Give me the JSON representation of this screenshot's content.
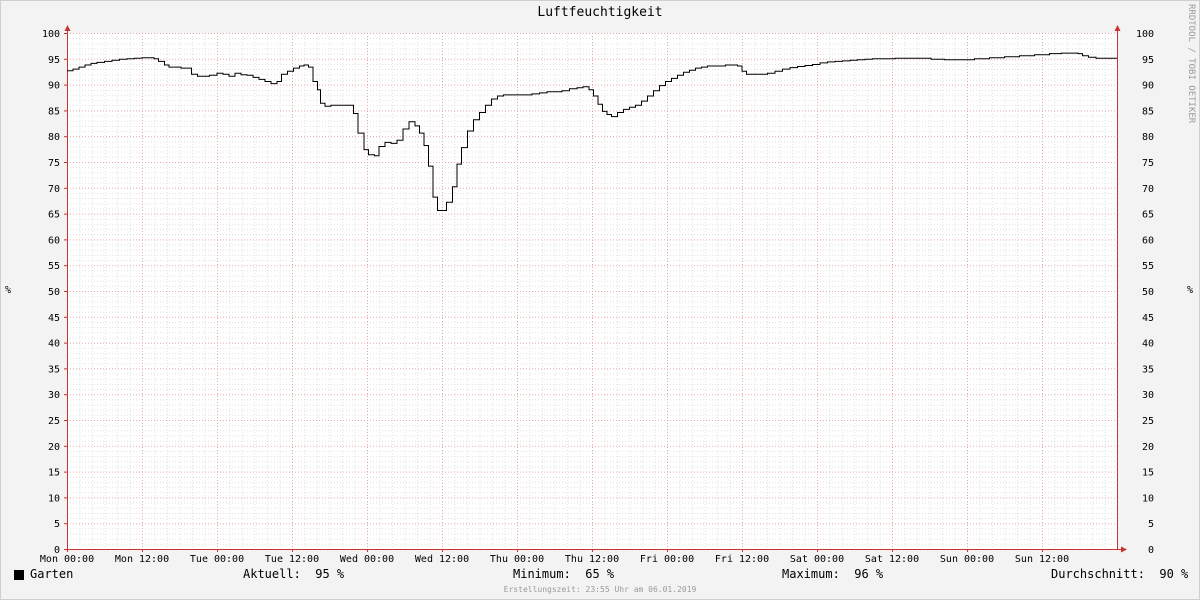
{
  "chart_data": {
    "type": "line",
    "title": "Luftfeuchtigkeit",
    "ylabel": "%",
    "ylabel_right": "%",
    "ylim": [
      0,
      100
    ],
    "yticks": [
      0,
      5,
      10,
      15,
      20,
      25,
      30,
      35,
      40,
      45,
      50,
      55,
      60,
      65,
      70,
      75,
      80,
      85,
      90,
      95,
      100
    ],
    "xlim": [
      0,
      7
    ],
    "xticks": [
      {
        "pos": 0,
        "label": "Mon 00:00"
      },
      {
        "pos": 0.5,
        "label": "Mon 12:00"
      },
      {
        "pos": 1,
        "label": "Tue 00:00"
      },
      {
        "pos": 1.5,
        "label": "Tue 12:00"
      },
      {
        "pos": 2,
        "label": "Wed 00:00"
      },
      {
        "pos": 2.5,
        "label": "Wed 12:00"
      },
      {
        "pos": 3,
        "label": "Thu 00:00"
      },
      {
        "pos": 3.5,
        "label": "Thu 12:00"
      },
      {
        "pos": 4,
        "label": "Fri 00:00"
      },
      {
        "pos": 4.5,
        "label": "Fri 12:00"
      },
      {
        "pos": 5,
        "label": "Sat 00:00"
      },
      {
        "pos": 5.5,
        "label": "Sat 12:00"
      },
      {
        "pos": 6,
        "label": "Sun 00:00"
      },
      {
        "pos": 6.5,
        "label": "Sun 12:00"
      }
    ],
    "grid": true,
    "series": [
      {
        "name": "Garten",
        "color": "#000000",
        "points": [
          [
            0.0,
            92.7
          ],
          [
            0.04,
            93.0
          ],
          [
            0.08,
            93.4
          ],
          [
            0.12,
            93.8
          ],
          [
            0.16,
            94.1
          ],
          [
            0.2,
            94.3
          ],
          [
            0.25,
            94.5
          ],
          [
            0.3,
            94.7
          ],
          [
            0.35,
            94.9
          ],
          [
            0.4,
            95.0
          ],
          [
            0.45,
            95.1
          ],
          [
            0.5,
            95.2
          ],
          [
            0.55,
            95.2
          ],
          [
            0.58,
            95.0
          ],
          [
            0.61,
            94.5
          ],
          [
            0.65,
            93.8
          ],
          [
            0.68,
            93.4
          ],
          [
            0.72,
            93.4
          ],
          [
            0.76,
            93.2
          ],
          [
            0.8,
            93.2
          ],
          [
            0.83,
            92.0
          ],
          [
            0.87,
            91.6
          ],
          [
            0.91,
            91.6
          ],
          [
            0.95,
            91.8
          ],
          [
            1.0,
            92.2
          ],
          [
            1.04,
            92.0
          ],
          [
            1.08,
            91.6
          ],
          [
            1.12,
            92.2
          ],
          [
            1.16,
            91.9
          ],
          [
            1.2,
            91.8
          ],
          [
            1.24,
            91.4
          ],
          [
            1.28,
            91.0
          ],
          [
            1.32,
            90.6
          ],
          [
            1.36,
            90.2
          ],
          [
            1.4,
            90.6
          ],
          [
            1.43,
            92.0
          ],
          [
            1.47,
            92.6
          ],
          [
            1.51,
            93.2
          ],
          [
            1.55,
            93.6
          ],
          [
            1.58,
            93.8
          ],
          [
            1.61,
            93.4
          ],
          [
            1.64,
            90.6
          ],
          [
            1.67,
            89.0
          ],
          [
            1.69,
            86.4
          ],
          [
            1.72,
            85.8
          ],
          [
            1.76,
            86.0
          ],
          [
            1.8,
            86.0
          ],
          [
            1.84,
            86.0
          ],
          [
            1.88,
            86.0
          ],
          [
            1.91,
            84.4
          ],
          [
            1.94,
            80.6
          ],
          [
            1.98,
            77.4
          ],
          [
            2.01,
            76.4
          ],
          [
            2.05,
            76.2
          ],
          [
            2.08,
            78.0
          ],
          [
            2.12,
            78.8
          ],
          [
            2.16,
            78.6
          ],
          [
            2.2,
            79.2
          ],
          [
            2.24,
            81.4
          ],
          [
            2.28,
            82.8
          ],
          [
            2.32,
            82.0
          ],
          [
            2.35,
            80.6
          ],
          [
            2.38,
            78.2
          ],
          [
            2.41,
            74.2
          ],
          [
            2.44,
            68.2
          ],
          [
            2.47,
            65.6
          ],
          [
            2.5,
            65.6
          ],
          [
            2.53,
            67.2
          ],
          [
            2.57,
            70.2
          ],
          [
            2.6,
            74.6
          ],
          [
            2.63,
            77.8
          ],
          [
            2.67,
            81.0
          ],
          [
            2.71,
            83.2
          ],
          [
            2.75,
            84.6
          ],
          [
            2.79,
            86.0
          ],
          [
            2.83,
            87.2
          ],
          [
            2.87,
            87.8
          ],
          [
            2.91,
            88.0
          ],
          [
            2.95,
            88.0
          ],
          [
            3.0,
            88.0
          ],
          [
            3.05,
            88.0
          ],
          [
            3.1,
            88.2
          ],
          [
            3.15,
            88.4
          ],
          [
            3.2,
            88.6
          ],
          [
            3.25,
            88.6
          ],
          [
            3.3,
            88.8
          ],
          [
            3.35,
            89.2
          ],
          [
            3.4,
            89.4
          ],
          [
            3.44,
            89.6
          ],
          [
            3.48,
            89.0
          ],
          [
            3.51,
            87.8
          ],
          [
            3.54,
            86.2
          ],
          [
            3.57,
            84.8
          ],
          [
            3.6,
            84.2
          ],
          [
            3.63,
            83.8
          ],
          [
            3.67,
            84.6
          ],
          [
            3.71,
            85.2
          ],
          [
            3.75,
            85.6
          ],
          [
            3.79,
            86.0
          ],
          [
            3.83,
            86.8
          ],
          [
            3.87,
            87.8
          ],
          [
            3.91,
            88.8
          ],
          [
            3.95,
            89.8
          ],
          [
            3.99,
            90.6
          ],
          [
            4.03,
            91.2
          ],
          [
            4.07,
            91.8
          ],
          [
            4.11,
            92.4
          ],
          [
            4.15,
            92.8
          ],
          [
            4.19,
            93.2
          ],
          [
            4.23,
            93.4
          ],
          [
            4.27,
            93.6
          ],
          [
            4.31,
            93.6
          ],
          [
            4.35,
            93.6
          ],
          [
            4.39,
            93.8
          ],
          [
            4.43,
            93.8
          ],
          [
            4.47,
            93.6
          ],
          [
            4.5,
            92.6
          ],
          [
            4.53,
            92.0
          ],
          [
            4.57,
            92.0
          ],
          [
            4.62,
            92.0
          ],
          [
            4.67,
            92.2
          ],
          [
            4.72,
            92.6
          ],
          [
            4.77,
            93.0
          ],
          [
            4.82,
            93.3
          ],
          [
            4.87,
            93.5
          ],
          [
            4.92,
            93.7
          ],
          [
            4.97,
            93.9
          ],
          [
            5.02,
            94.2
          ],
          [
            5.07,
            94.4
          ],
          [
            5.12,
            94.5
          ],
          [
            5.17,
            94.6
          ],
          [
            5.22,
            94.7
          ],
          [
            5.27,
            94.8
          ],
          [
            5.32,
            94.9
          ],
          [
            5.37,
            95.0
          ],
          [
            5.45,
            95.0
          ],
          [
            5.52,
            95.1
          ],
          [
            5.6,
            95.1
          ],
          [
            5.68,
            95.1
          ],
          [
            5.76,
            94.9
          ],
          [
            5.85,
            94.8
          ],
          [
            5.95,
            94.8
          ],
          [
            6.05,
            95.0
          ],
          [
            6.15,
            95.2
          ],
          [
            6.25,
            95.4
          ],
          [
            6.35,
            95.6
          ],
          [
            6.45,
            95.8
          ],
          [
            6.55,
            96.0
          ],
          [
            6.63,
            96.1
          ],
          [
            6.7,
            96.1
          ],
          [
            6.74,
            96.0
          ],
          [
            6.77,
            95.6
          ],
          [
            6.81,
            95.3
          ],
          [
            6.86,
            95.1
          ],
          [
            6.92,
            95.1
          ],
          [
            7.0,
            95.1
          ]
        ]
      }
    ]
  },
  "legend": {
    "series_label": "Garten",
    "aktuell": "Aktuell:  95 %",
    "minimum": "Minimum:  65 %",
    "maximum": "Maximum:  96 %",
    "durchschnitt": "Durchschnitt:  90 %"
  },
  "side_text": "RRDTOOL / TOBI OETIKER",
  "footer": "Erstellungszeit: 23:55 Uhr am 06.01.2019"
}
